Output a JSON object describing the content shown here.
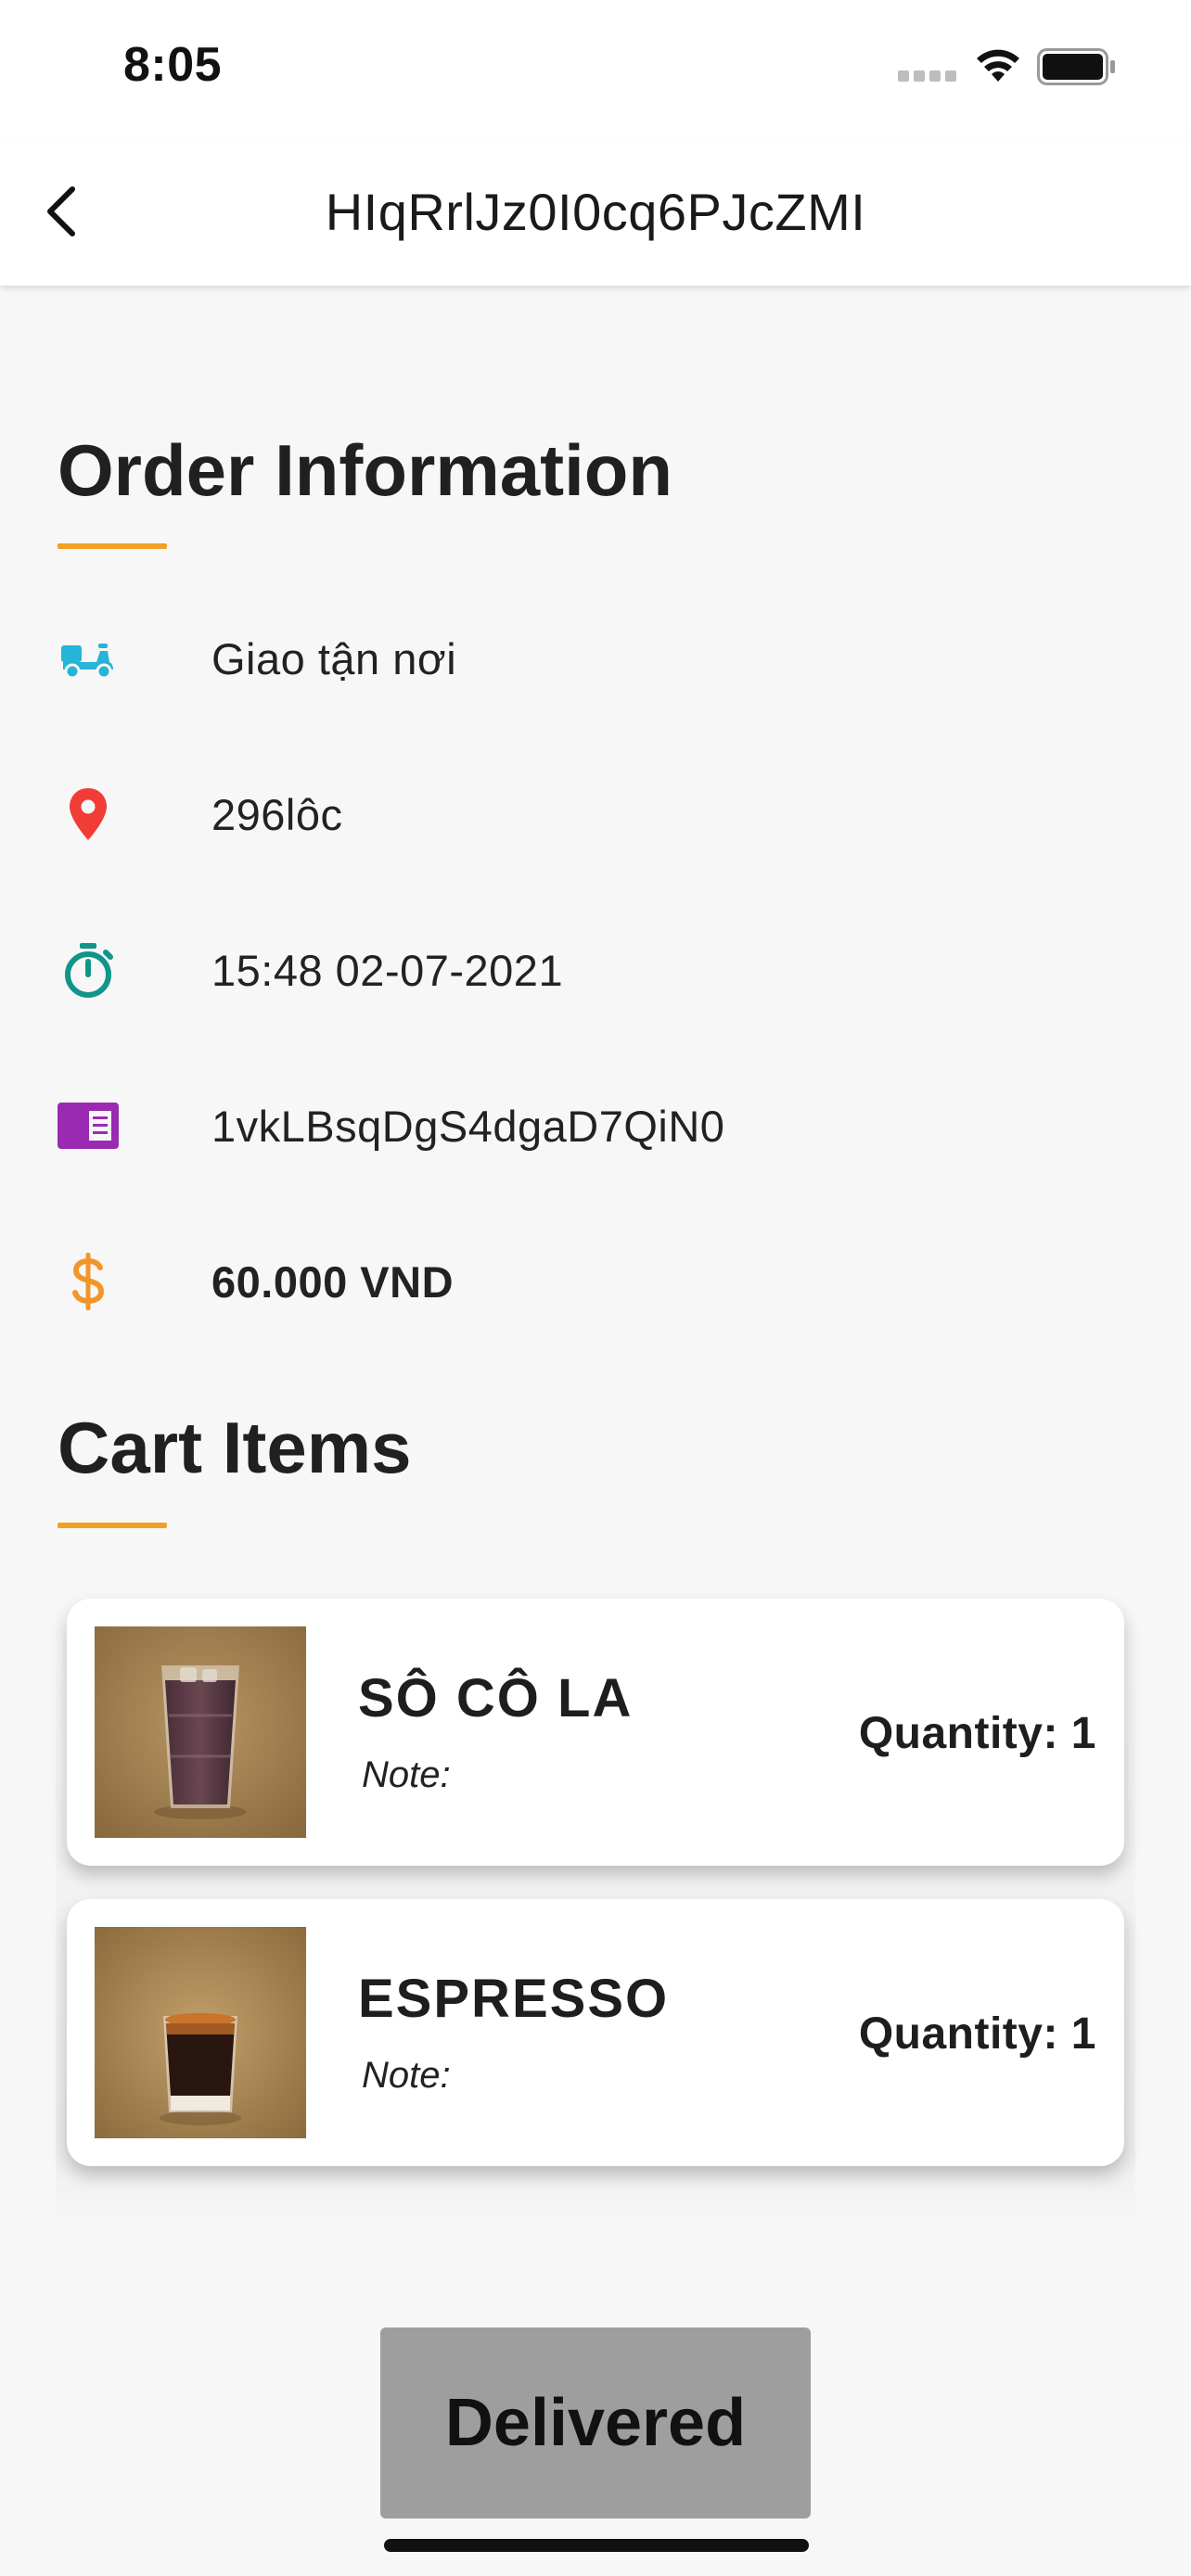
{
  "status_bar": {
    "time": "8:05",
    "icons": [
      "cellular-dots-icon",
      "wifi-icon",
      "battery-icon"
    ]
  },
  "nav": {
    "back_icon": "chevron-left-icon",
    "title": "HIqRrlJz0I0cq6PJcZMI"
  },
  "order_info": {
    "heading": "Order Information",
    "rows": [
      {
        "icon": "delivery-scooter-icon",
        "icon_color": "#26b4d8",
        "text": "Giao tận nơi"
      },
      {
        "icon": "location-pin-icon",
        "icon_color": "#f03e36",
        "text": "296lôc"
      },
      {
        "icon": "timer-icon",
        "icon_color": "#11958a",
        "text": "15:48 02-07-2021"
      },
      {
        "icon": "receipt-card-icon",
        "icon_color": "#9b2ab3",
        "text": "1vkLBsqDgS4dgaD7QiN0"
      },
      {
        "icon": "dollar-icon",
        "icon_color": "#f3962a",
        "text": "60.000 VND"
      }
    ]
  },
  "cart": {
    "heading": "Cart Items",
    "items": [
      {
        "name": "SÔ CÔ LA",
        "note_label": "Note:",
        "quantity_label": "Quantity: 1",
        "image": "chocolate-drink-photo"
      },
      {
        "name": "ESPRESSO",
        "note_label": "Note:",
        "quantity_label": "Quantity: 1",
        "image": "espresso-shot-photo"
      }
    ]
  },
  "action": {
    "button_label": "Delivered"
  },
  "colors": {
    "accent_underline": "#f2a023",
    "button_bg": "#9e9e9e",
    "page_bg": "#f7f7f7"
  }
}
